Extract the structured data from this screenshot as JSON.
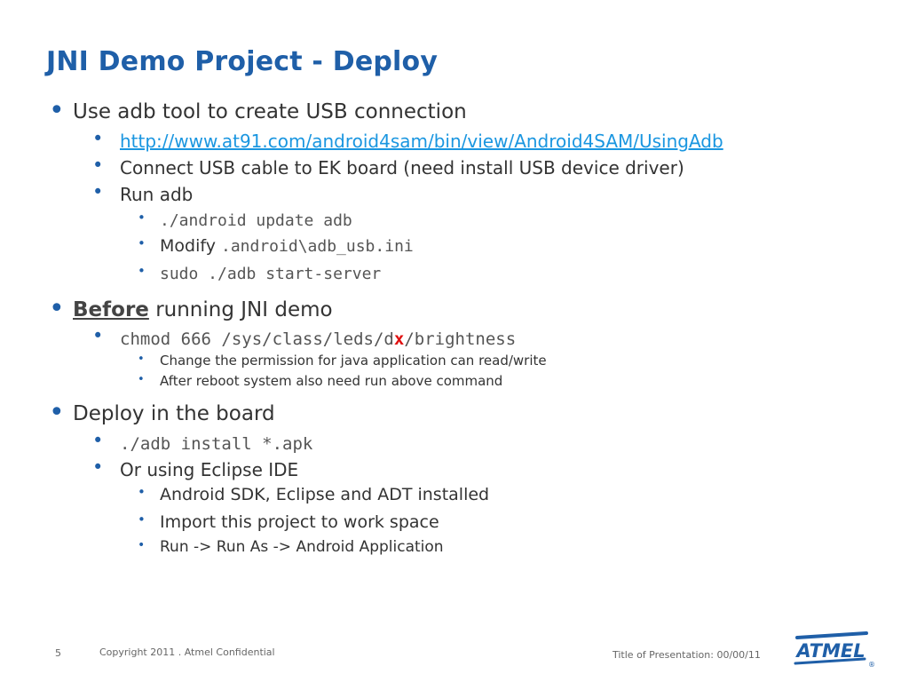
{
  "slide": {
    "title": "JNI Demo Project - Deploy",
    "items": {
      "s1": {
        "text": "Use adb tool to create USB connection"
      },
      "s1_link": {
        "text": "http://www.at91.com/android4sam/bin/view/Android4SAM/UsingAdb"
      },
      "s1_usb": {
        "text": "Connect USB cable to EK board (need install USB device driver)"
      },
      "s1_run": {
        "text": "Run adb"
      },
      "s1_run_a": {
        "code": "./android update adb"
      },
      "s1_run_b": {
        "prefix": "Modify ",
        "code": ".android\\adb_usb.ini"
      },
      "s1_run_c": {
        "code": "sudo ./adb start-server"
      },
      "s2": {
        "bold": "Before",
        "rest": " running JNI demo"
      },
      "s2_chmod": {
        "code_before": "chmod 666 /sys/class/leds/d",
        "highlight": "x",
        "code_after": "/brightness"
      },
      "s2_a": {
        "text": "Change the permission for java application can read/write"
      },
      "s2_b": {
        "text": "After reboot system also need run above command"
      },
      "s3": {
        "text": "Deploy in the board"
      },
      "s3_install": {
        "code": "./adb install *.apk"
      },
      "s3_eclipse": {
        "text": "Or using Eclipse IDE"
      },
      "s3_e1": {
        "text": "Android SDK, Eclipse and ADT installed"
      },
      "s3_e2": {
        "text": "Import this project to work space"
      },
      "s3_e3": {
        "text": "Run -> Run As -> Android Application"
      }
    }
  },
  "footer": {
    "page_number": "5",
    "copyright": "Copyright 2011 . Atmel Confidential",
    "presentation": "Title of Presentation: 00/00/11",
    "logo_text": "ATMEL",
    "logo_reg": "®"
  },
  "colors": {
    "title": "#1f5fa8",
    "bullet": "#1f5fa8",
    "link": "#1a96e0",
    "highlight": "#e01010"
  }
}
